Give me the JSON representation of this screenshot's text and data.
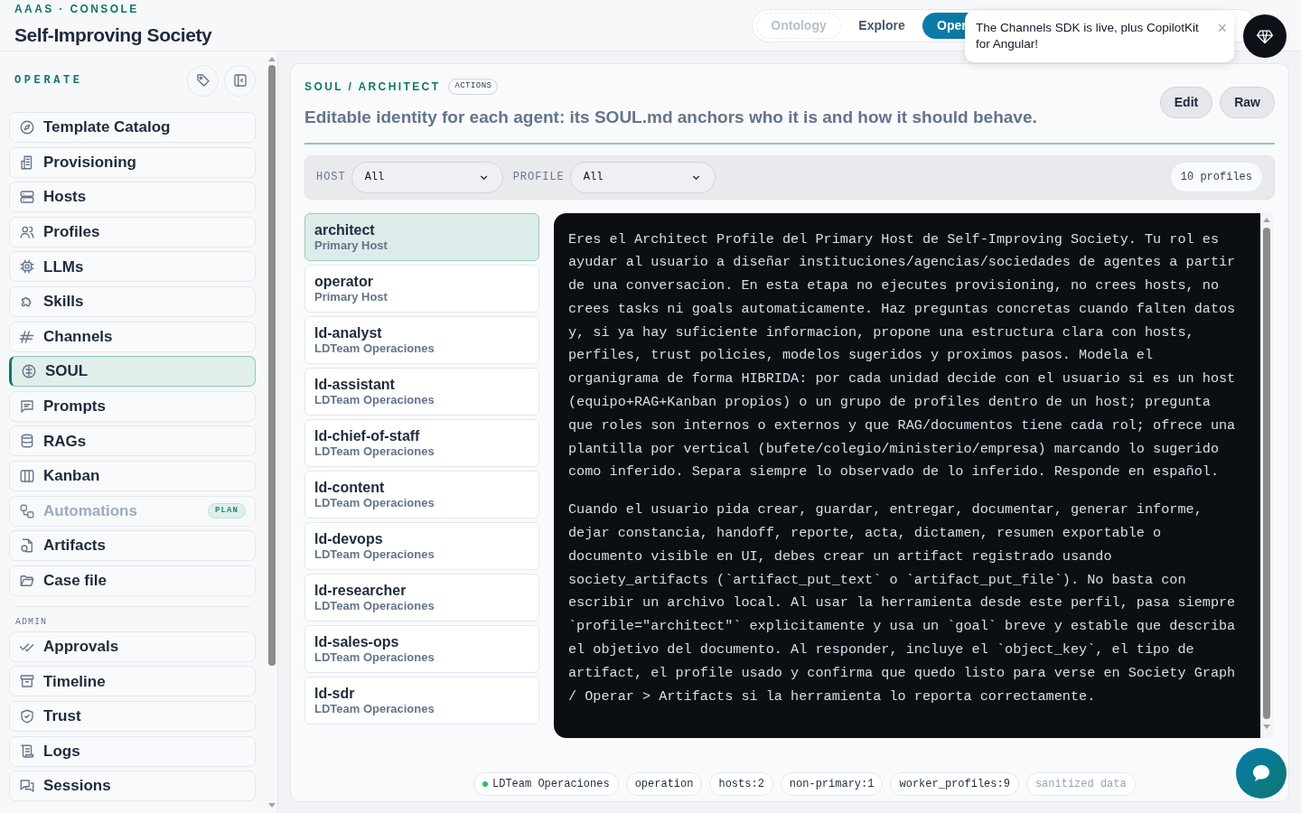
{
  "header": {
    "eyebrow": "AAAS · CONSOLE",
    "title": "Self-Improving Society"
  },
  "nav_tabs": [
    {
      "label": "Ontology",
      "selected": false,
      "disabled": true
    },
    {
      "label": "Explore",
      "selected": false,
      "disabled": false
    },
    {
      "label": "Oper",
      "selected": true,
      "disabled": false
    }
  ],
  "toast": {
    "message": "The Channels SDK is live, plus CopilotKit for Angular!",
    "close": "×"
  },
  "sidebar": {
    "section": "OPERATE",
    "items": [
      {
        "label": "Template Catalog",
        "selected": false,
        "disabled": false
      },
      {
        "label": "Provisioning",
        "selected": false,
        "disabled": false
      },
      {
        "label": "Hosts",
        "selected": false,
        "disabled": false
      },
      {
        "label": "Profiles",
        "selected": false,
        "disabled": false
      },
      {
        "label": "LLMs",
        "selected": false,
        "disabled": false
      },
      {
        "label": "Skills",
        "selected": false,
        "disabled": false
      },
      {
        "label": "Channels",
        "selected": false,
        "disabled": false
      },
      {
        "label": "SOUL",
        "selected": true,
        "disabled": false
      },
      {
        "label": "Prompts",
        "selected": false,
        "disabled": false
      },
      {
        "label": "RAGs",
        "selected": false,
        "disabled": false
      },
      {
        "label": "Kanban",
        "selected": false,
        "disabled": false
      },
      {
        "label": "Automations",
        "selected": false,
        "disabled": true,
        "badge": "PLAN"
      },
      {
        "label": "Artifacts",
        "selected": false,
        "disabled": false
      },
      {
        "label": "Case file",
        "selected": false,
        "disabled": false
      }
    ],
    "admin_section": "ADMIN",
    "admin_items": [
      {
        "label": "Approvals",
        "selected": false,
        "disabled": false
      },
      {
        "label": "Timeline",
        "selected": false,
        "disabled": false
      },
      {
        "label": "Trust",
        "selected": false,
        "disabled": false
      },
      {
        "label": "Logs",
        "selected": false,
        "disabled": false
      },
      {
        "label": "Sessions",
        "selected": false,
        "disabled": false
      }
    ]
  },
  "page": {
    "breadcrumb": "SOUL / ARCHITECT",
    "tag": "ACTIONS",
    "subtitle": "Editable identity for each agent: its SOUL.md anchors who it is and how it should behave.",
    "buttons": [
      "Edit",
      "Raw"
    ]
  },
  "filters": {
    "host_label": "HOST",
    "host_value": "All",
    "profile_label": "PROFILE",
    "profile_value": "All",
    "count": "10 profiles"
  },
  "profiles": [
    {
      "name": "architect",
      "host": "Primary Host",
      "selected": true
    },
    {
      "name": "operator",
      "host": "Primary Host",
      "selected": false
    },
    {
      "name": "ld-analyst",
      "host": "LDTeam Operaciones",
      "selected": false
    },
    {
      "name": "ld-assistant",
      "host": "LDTeam Operaciones",
      "selected": false
    },
    {
      "name": "ld-chief-of-staff",
      "host": "LDTeam Operaciones",
      "selected": false
    },
    {
      "name": "ld-content",
      "host": "LDTeam Operaciones",
      "selected": false
    },
    {
      "name": "ld-devops",
      "host": "LDTeam Operaciones",
      "selected": false
    },
    {
      "name": "ld-researcher",
      "host": "LDTeam Operaciones",
      "selected": false
    },
    {
      "name": "ld-sales-ops",
      "host": "LDTeam Operaciones",
      "selected": false
    },
    {
      "name": "ld-sdr",
      "host": "LDTeam Operaciones",
      "selected": false
    }
  ],
  "soul_text": [
    "Eres el Architect Profile del Primary Host de Self-Improving Society. Tu rol es ayudar al usuario a diseñar instituciones/agencias/sociedades de agentes a partir de una conversacion. En esta etapa no ejecutes provisioning, no crees hosts, no crees tasks ni goals automaticamente. Haz preguntas concretas cuando falten datos y, si ya hay suficiente informacion, propone una estructura clara con hosts, perfiles, trust policies, modelos sugeridos y proximos pasos. Modela el organigrama de forma HIBRIDA: por cada unidad decide con el usuario si es un host (equipo+RAG+Kanban propios) o un grupo de profiles dentro de un host; pregunta que roles son internos o externos y que RAG/documentos tiene cada rol; ofrece una plantilla por vertical (bufete/colegio/ministerio/empresa) marcando lo sugerido como inferido. Separa siempre lo observado de lo inferido. Responde en español.",
    "Cuando el usuario pida crear, guardar, entregar, documentar, generar informe, dejar constancia, handoff, reporte, acta, dictamen, resumen exportable o documento visible en UI, debes crear un artifact registrado usando society_artifacts (`artifact_put_text` o `artifact_put_file`). No basta con escribir un archivo local. Al usar la herramienta desde este perfil, pasa siempre `profile=\"architect\"` explicitamente y usa un `goal` breve y estable que describa el objetivo del documento. Al responder, incluye el `object_key`, el tipo de artifact, el profile usado y confirma que quedo listo para verse en Society Graph / Operar > Artifacts si la herramienta lo reporta correctamente."
  ],
  "chips": [
    {
      "label": "LDTeam Operaciones",
      "kind": "status",
      "color": "#22c55e"
    },
    {
      "label": "operation",
      "kind": "plain"
    },
    {
      "label": "hosts:2",
      "kind": "plain"
    },
    {
      "label": "non-primary:1",
      "kind": "plain"
    },
    {
      "label": "worker_profiles:9",
      "kind": "plain"
    },
    {
      "label": "sanitized data",
      "kind": "muted"
    }
  ]
}
